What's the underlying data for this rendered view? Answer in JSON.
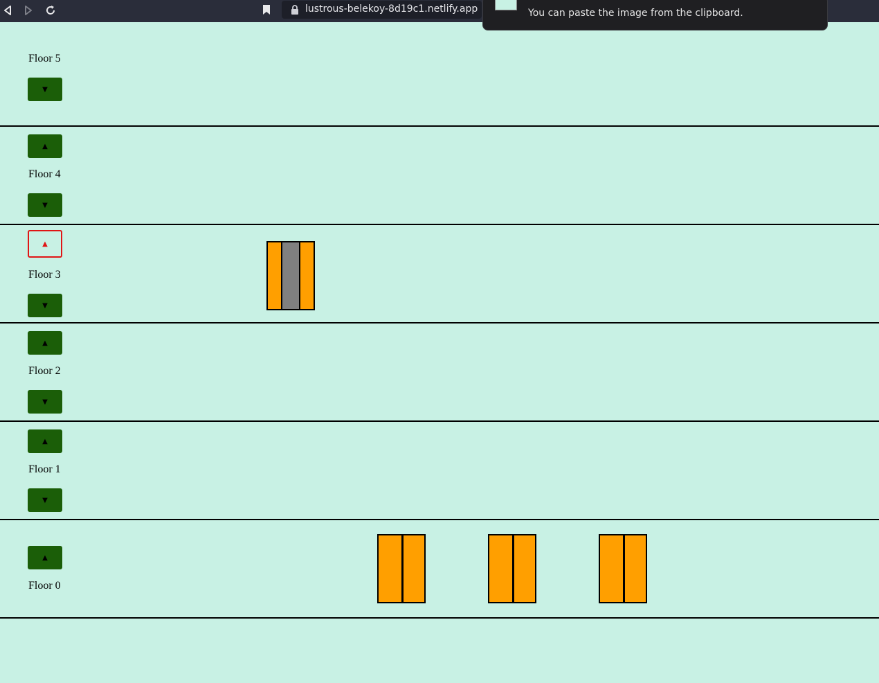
{
  "browser": {
    "url": "lustrous-belekoy-8d19c1.netlify.app",
    "toast_message": "You can paste the image from the clipboard."
  },
  "floors": [
    {
      "label": "Floor 5",
      "up_symbol": "",
      "down_symbol": "▼"
    },
    {
      "label": "Floor 4",
      "up_symbol": "▲",
      "down_symbol": "▼"
    },
    {
      "label": "Floor 3",
      "up_symbol": "▲",
      "down_symbol": "▼",
      "up_active": true
    },
    {
      "label": "Floor 2",
      "up_symbol": "▲",
      "down_symbol": "▼"
    },
    {
      "label": "Floor 1",
      "up_symbol": "▲",
      "down_symbol": "▼"
    },
    {
      "label": "Floor 0",
      "up_symbol": "▲",
      "down_symbol": ""
    }
  ],
  "elevators": [
    {
      "floor": 3,
      "doors": "open"
    },
    {
      "floor": 0,
      "doors": "closed"
    },
    {
      "floor": 0,
      "doors": "closed"
    },
    {
      "floor": 0,
      "doors": "closed"
    }
  ],
  "colors": {
    "background": "#c8f1e4",
    "button": "#1b5e08",
    "active_border": "#e01515",
    "elevator": "#ff9f00",
    "elevator_interior": "#808080"
  }
}
